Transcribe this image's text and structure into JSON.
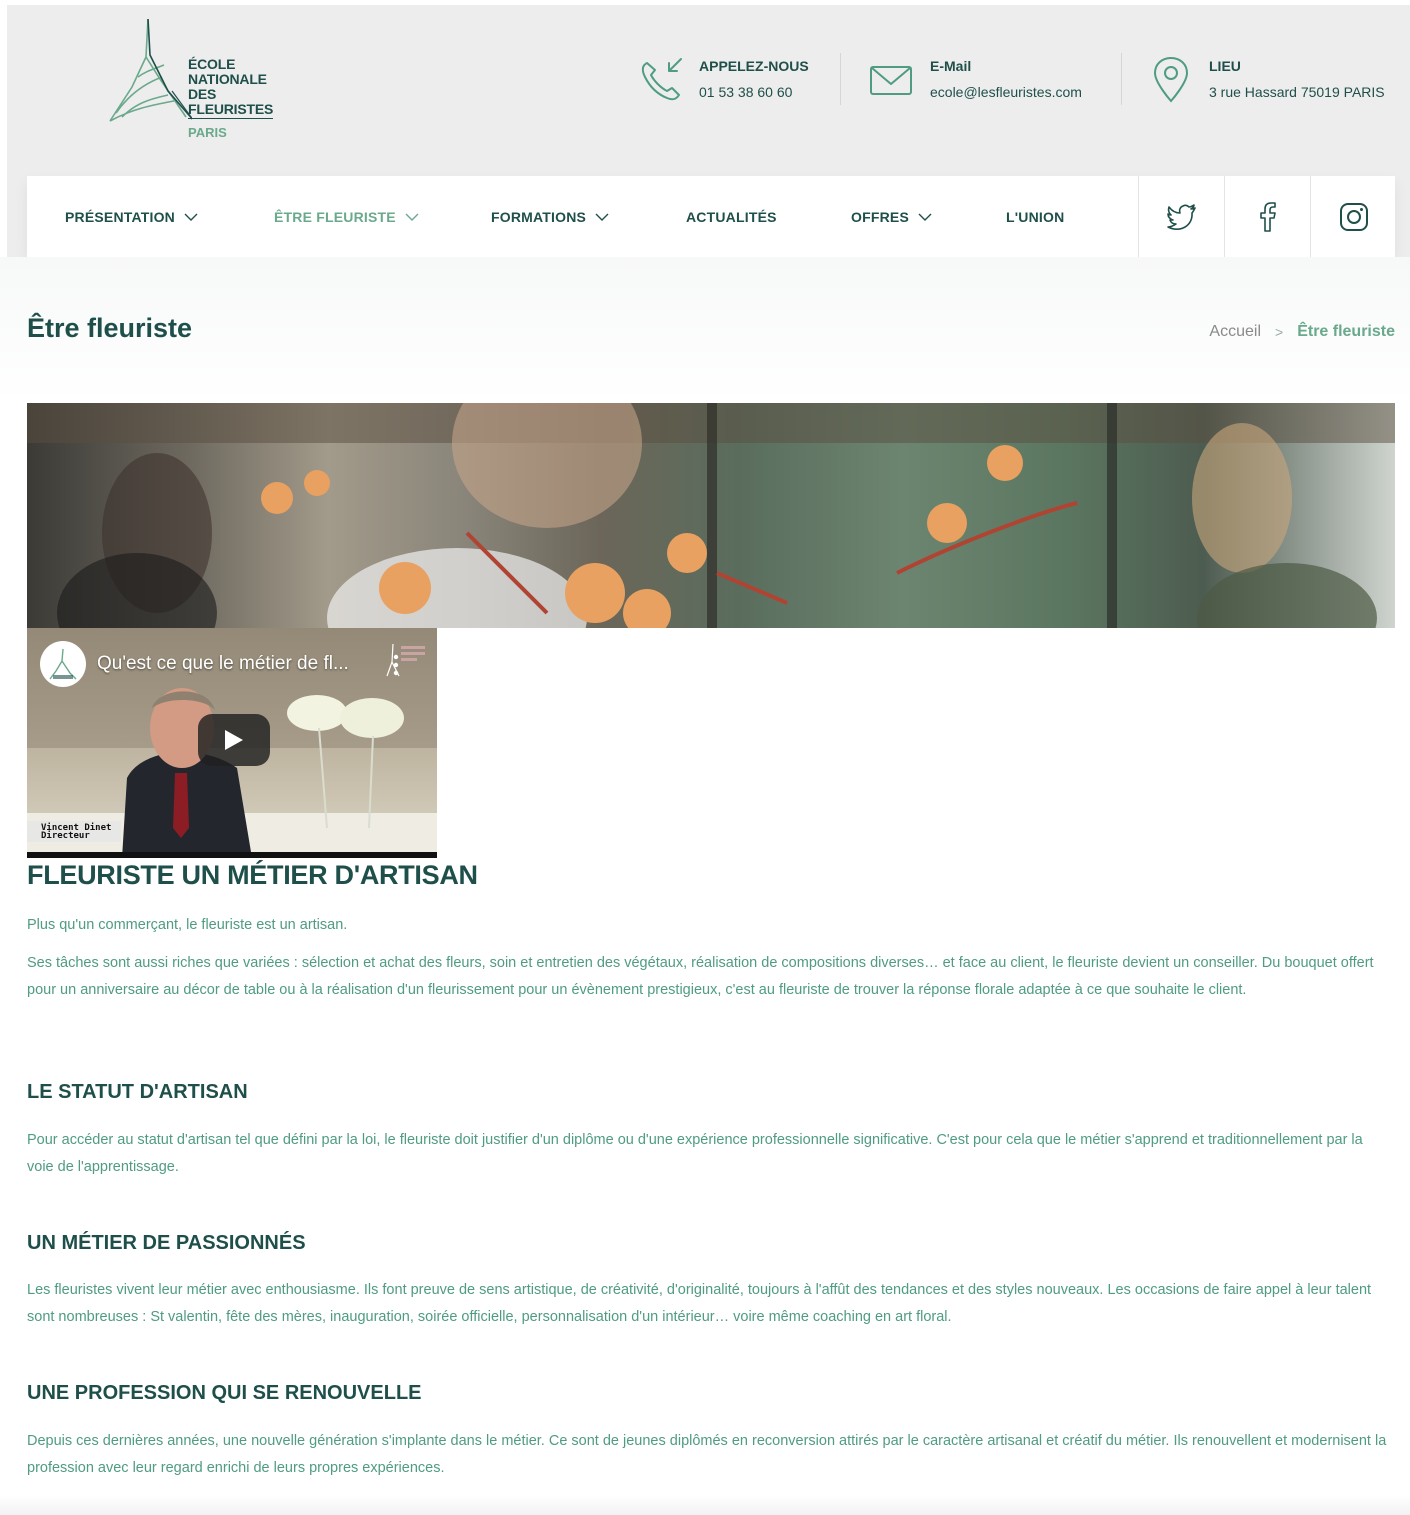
{
  "header": {
    "logo": {
      "lines": [
        "ÉCOLE",
        "NATIONALE",
        "DES",
        "FLEURISTES"
      ],
      "city": "PARIS"
    },
    "contacts": [
      {
        "icon": "phone-icon",
        "title": "APPELEZ-NOUS",
        "value": "01 53 38 60 60"
      },
      {
        "icon": "mail-icon",
        "title": "E-Mail",
        "value": "ecole@lesfleuristes.com"
      },
      {
        "icon": "location-pin-icon",
        "title": "LIEU",
        "value": "3 rue Hassard 75019 PARIS"
      }
    ]
  },
  "nav": {
    "items": [
      {
        "label": "PRÉSENTATION",
        "dropdown": true,
        "active": false
      },
      {
        "label": "ÊTRE FLEURISTE",
        "dropdown": true,
        "active": true
      },
      {
        "label": "FORMATIONS",
        "dropdown": true,
        "active": false
      },
      {
        "label": "ACTUALITÉS",
        "dropdown": false,
        "active": false
      },
      {
        "label": "OFFRES",
        "dropdown": true,
        "active": false
      },
      {
        "label": "L'UNION",
        "dropdown": false,
        "active": false
      }
    ],
    "social": [
      "twitter-icon",
      "facebook-icon",
      "instagram-icon"
    ]
  },
  "page": {
    "title": "Être fleuriste",
    "breadcrumb": {
      "home": "Accueil",
      "separator": ">",
      "current": "Être fleuriste"
    }
  },
  "video": {
    "title": "Qu'est ce que le métier de fl...",
    "caption_name": "Vincent Dinet",
    "caption_role": "Directeur"
  },
  "content": {
    "heading": "FLEURISTE UN MÉTIER D'ARTISAN",
    "intro": "Plus qu'un commerçant, le fleuriste est un artisan.",
    "intro2": "Ses tâches sont aussi riches que variées : sélection et achat des fleurs, soin et entretien des végétaux, réalisation de compositions diverses… et face au client, le fleuriste devient un conseiller. Du bouquet offert pour un anniversaire au décor de table ou à la réalisation d'un fleurissement pour un évènement prestigieux, c'est au fleuriste de trouver la réponse florale adaptée à ce que souhaite le client.",
    "sections": [
      {
        "title": "LE STATUT D'ARTISAN",
        "text": "Pour accéder au statut d'artisan tel que défini par la loi, le fleuriste doit justifier d'un diplôme ou d'une expérience professionnelle significative. C'est pour cela que le métier s'apprend et traditionnellement par la voie de l'apprentissage."
      },
      {
        "title": "UN MÉTIER DE PASSIONNÉS",
        "text": "Les fleuristes vivent leur métier avec enthousiasme. Ils font preuve de sens artistique, de créativité, d'originalité, toujours à l'affût des tendances et des styles nouveaux. Les occasions de faire appel à leur talent sont nombreuses : St valentin, fête des mères, inauguration, soirée officielle, personnalisation d'un intérieur… voire même coaching en art floral."
      },
      {
        "title": "UNE PROFESSION QUI SE RENOUVELLE",
        "text": "Depuis ces dernières années, une nouvelle génération s'implante dans le métier. Ce sont de jeunes diplômés en reconversion attirés par le caractère artisanal et créatif du métier. Ils renouvellent et modernisent la profession avec leur regard enrichi de leurs propres expériences."
      }
    ]
  },
  "colors": {
    "brand_dark": "#1f4f4a",
    "brand_green": "#6aa98c",
    "text_green": "#4f9c80",
    "header_bg": "#ededed"
  }
}
